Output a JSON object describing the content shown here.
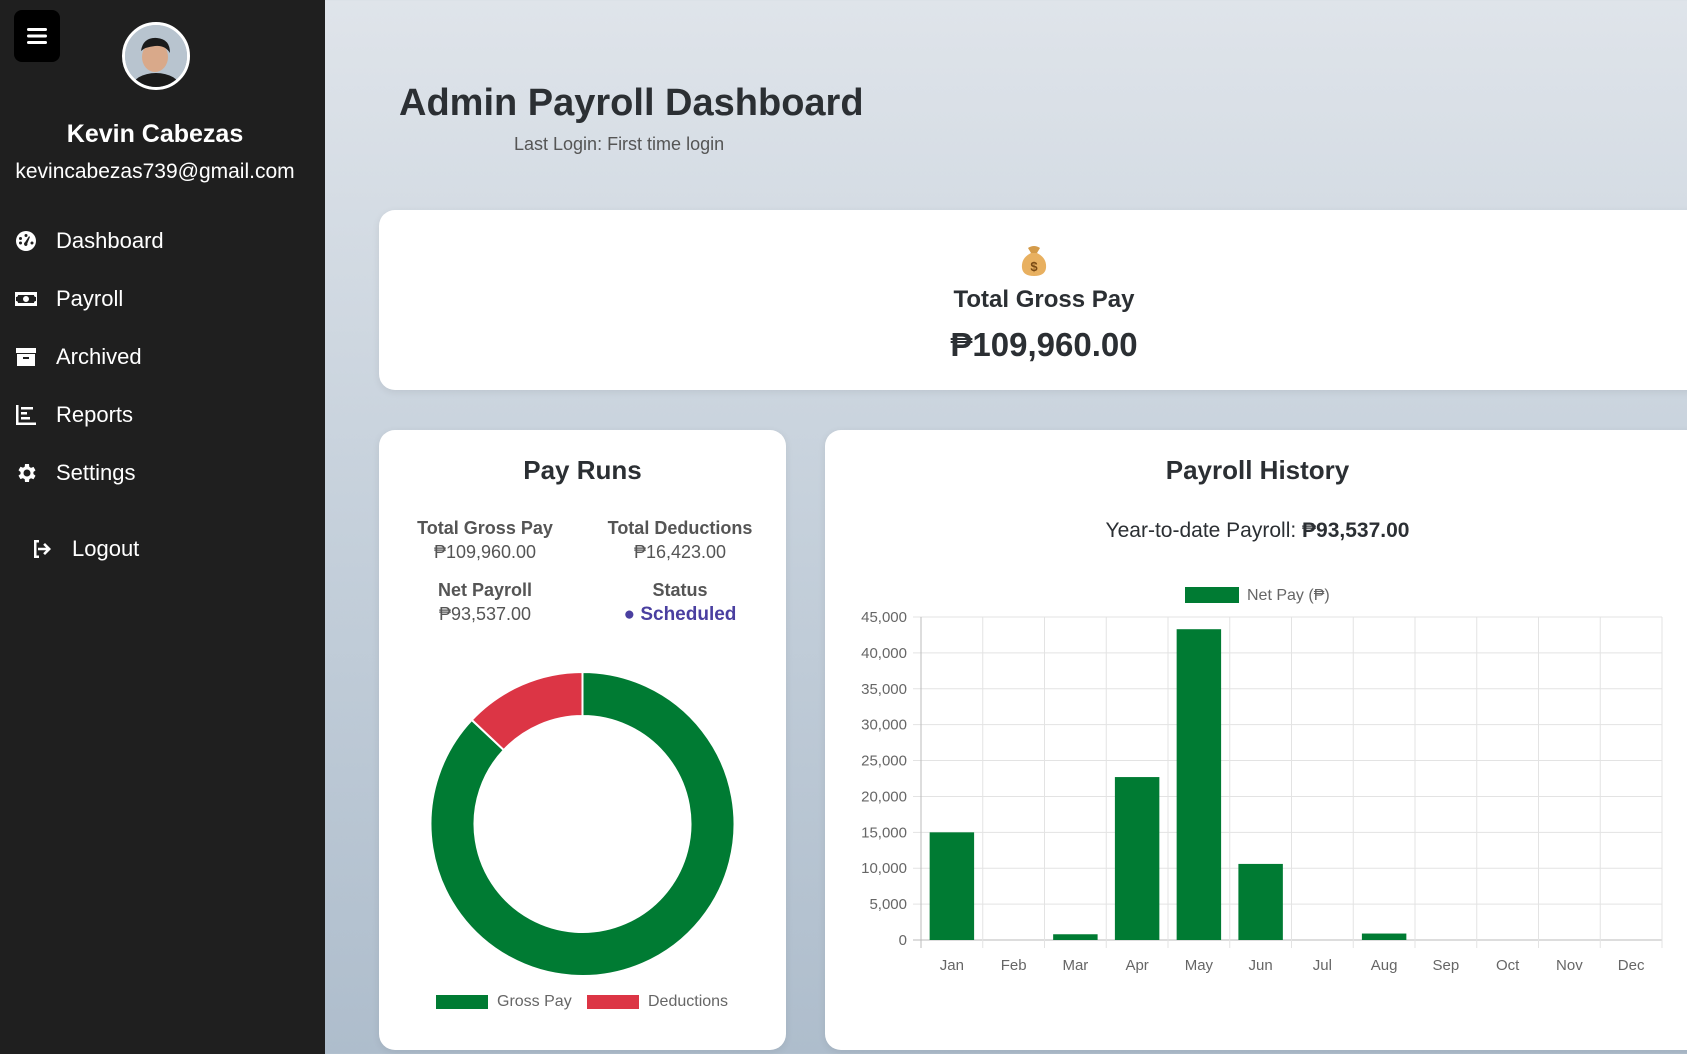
{
  "sidebar": {
    "user_name": "Kevin Cabezas",
    "user_email": "kevincabezas739@gmail.com",
    "items": [
      {
        "label": "Dashboard",
        "icon": "dashboard-icon"
      },
      {
        "label": "Payroll",
        "icon": "money-icon"
      },
      {
        "label": "Archived",
        "icon": "archive-icon"
      },
      {
        "label": "Reports",
        "icon": "chart-icon"
      },
      {
        "label": "Settings",
        "icon": "gear-icon"
      }
    ],
    "logout": "Logout"
  },
  "header": {
    "title": "Admin Payroll Dashboard",
    "last_login": "Last Login: First time login"
  },
  "gross_card": {
    "icon": "money-bag-icon",
    "label": "Total Gross Pay",
    "value": "₱109,960.00"
  },
  "pay_runs": {
    "title": "Pay Runs",
    "total_gross_label": "Total Gross Pay",
    "total_gross_value": "₱109,960.00",
    "total_deductions_label": "Total Deductions",
    "total_deductions_value": "₱16,423.00",
    "net_payroll_label": "Net Payroll",
    "net_payroll_value": "₱93,537.00",
    "status_label": "Status",
    "status_value": "● Scheduled",
    "donut": {
      "legend": [
        "Gross Pay",
        "Deductions"
      ],
      "values": [
        109960,
        16423
      ],
      "colors": [
        "#007b33",
        "#dc3545"
      ]
    }
  },
  "history": {
    "title": "Payroll History",
    "ytd_label": "Year-to-date Payroll: ",
    "ytd_value": "₱93,537.00"
  },
  "chart_data": {
    "type": "bar",
    "legend": "Net Pay (₱)",
    "categories": [
      "Jan",
      "Feb",
      "Mar",
      "Apr",
      "May",
      "Jun",
      "Jul",
      "Aug",
      "Sep",
      "Oct",
      "Nov",
      "Dec"
    ],
    "values": [
      15000,
      0,
      800,
      22700,
      43300,
      10600,
      0,
      900,
      0,
      0,
      0,
      0
    ],
    "ylim": [
      0,
      45000
    ],
    "yticks": [
      "0",
      "5,000",
      "10,000",
      "15,000",
      "20,000",
      "25,000",
      "30,000",
      "35,000",
      "40,000",
      "45,000"
    ],
    "color": "#007b33",
    "grid": true,
    "legend_position": "top"
  }
}
